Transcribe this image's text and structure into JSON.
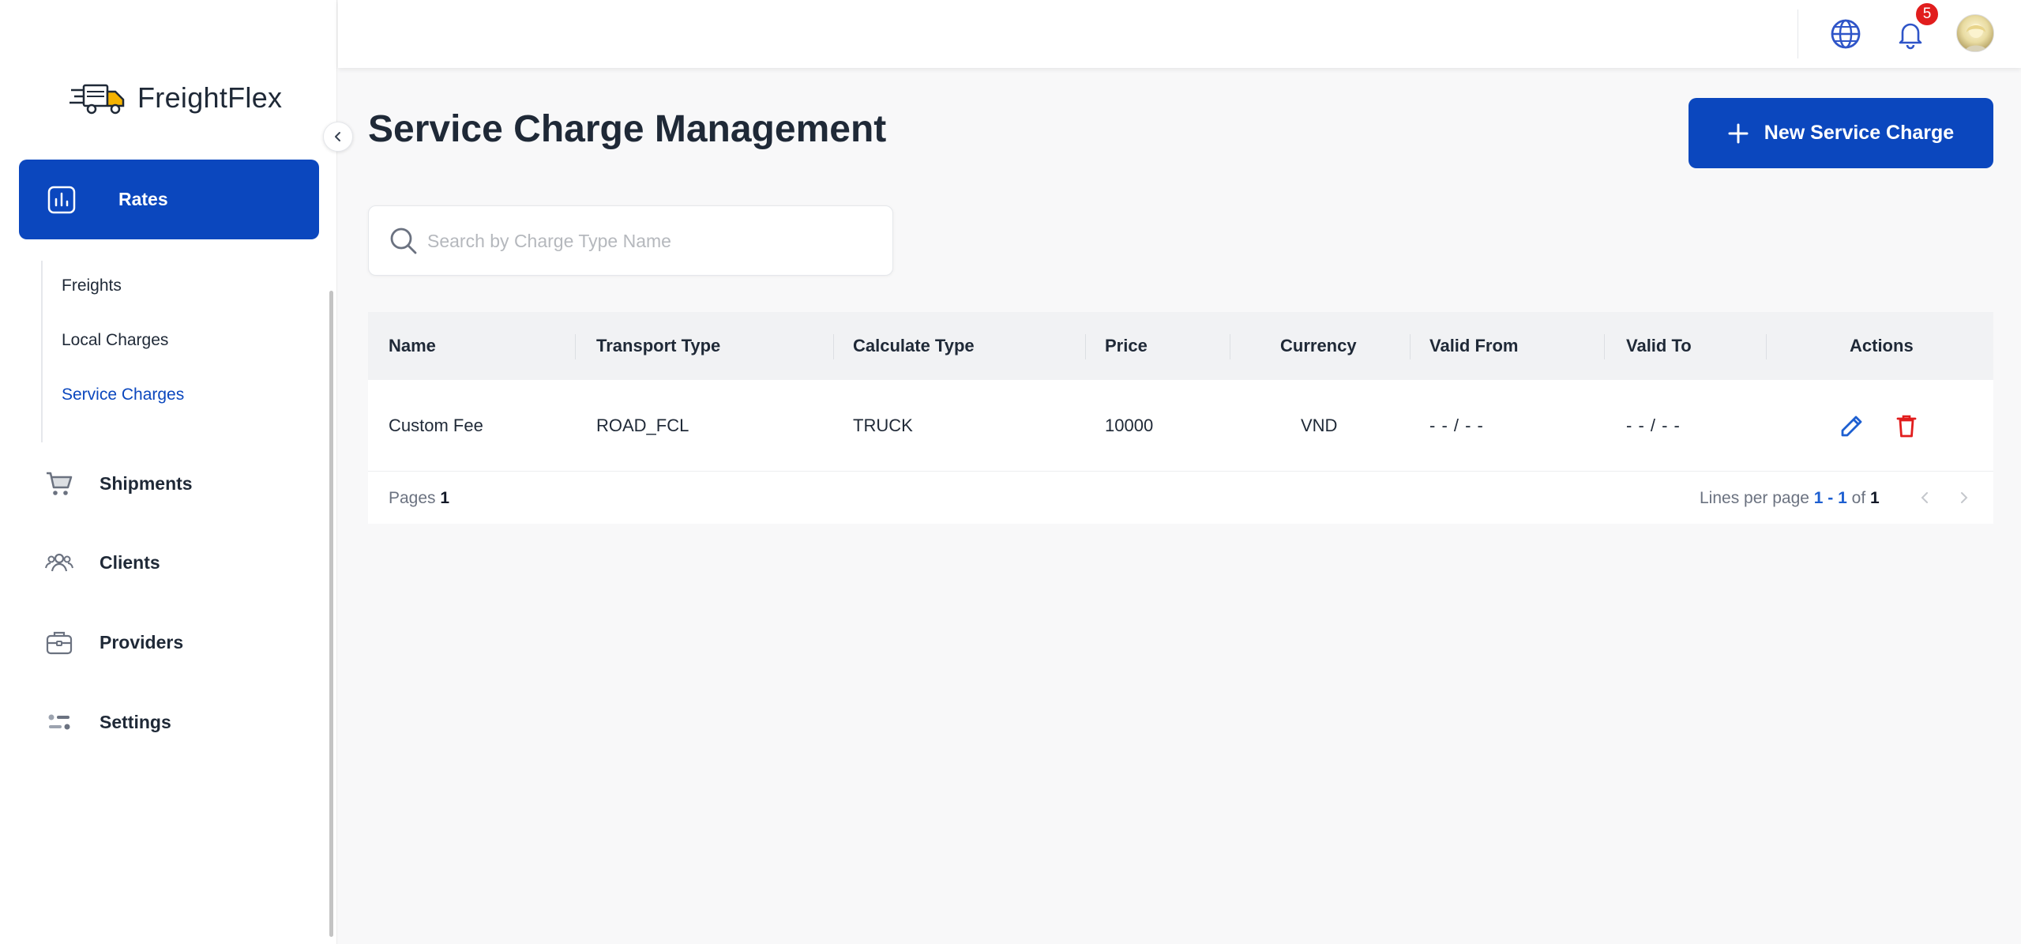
{
  "app": {
    "name": "FreightFlex"
  },
  "sidebar": {
    "active_item": {
      "label": "Rates",
      "icon": "chart-bar-icon"
    },
    "submenu": [
      {
        "label": "Freights",
        "active": false
      },
      {
        "label": "Local Charges",
        "active": false
      },
      {
        "label": "Service Charges",
        "active": true
      }
    ],
    "items": [
      {
        "label": "Shipments",
        "icon": "cart-icon"
      },
      {
        "label": "Clients",
        "icon": "users-icon"
      },
      {
        "label": "Providers",
        "icon": "briefcase-icon"
      },
      {
        "label": "Settings",
        "icon": "sliders-icon"
      }
    ]
  },
  "header": {
    "notification_count": "5",
    "icons": [
      "globe-icon",
      "bell-icon",
      "avatar"
    ]
  },
  "main": {
    "title": "Service Charge Management",
    "new_button_label": "New Service Charge",
    "search_placeholder": "Search by Charge Type Name",
    "search_value": ""
  },
  "table": {
    "columns": [
      "Name",
      "Transport Type",
      "Calculate Type",
      "Price",
      "Currency",
      "Valid From",
      "Valid To",
      "Actions"
    ],
    "rows": [
      {
        "name": "Custom Fee",
        "transport_type": "ROAD_FCL",
        "calculate_type": "TRUCK",
        "price": "10000",
        "currency": "VND",
        "valid_from": "- - / - -",
        "valid_to": "- - / - -"
      }
    ],
    "footer": {
      "pages_label": "Pages",
      "pages_value": "1",
      "lines_label": "Lines per page",
      "range": "1 - 1",
      "of_label": "of",
      "total": "1"
    }
  },
  "colors": {
    "primary": "#0b47be",
    "danger": "#e11d1d",
    "edit_icon": "#1d5fd1"
  }
}
